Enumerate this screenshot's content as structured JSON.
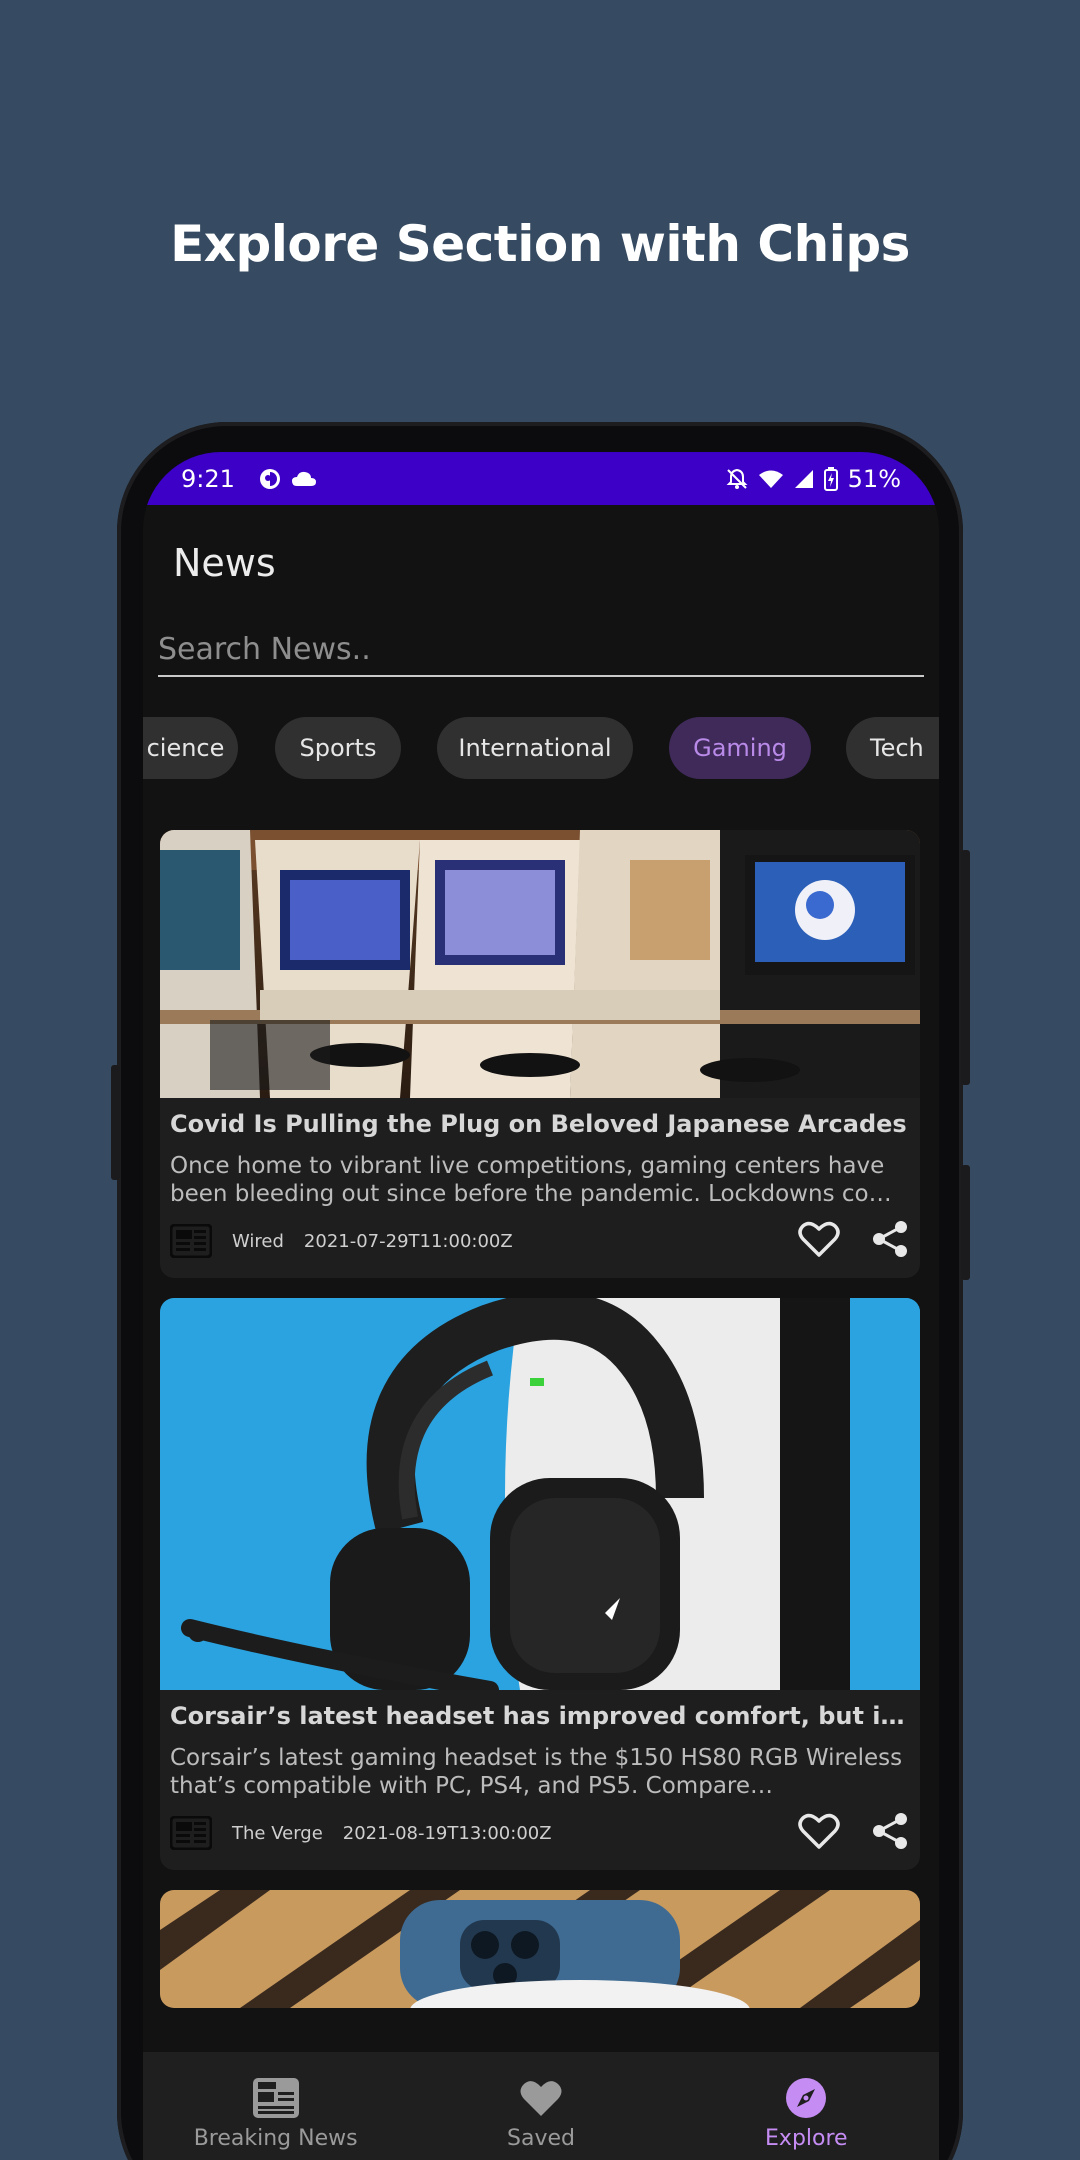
{
  "headline": "Explore Section with Chips",
  "status_bar": {
    "time": "9:21",
    "battery": "51%",
    "left_icons": [
      "app-notification-icon",
      "cloud-icon"
    ],
    "right_icons": [
      "bell-off-icon",
      "wifi-icon",
      "signal-icon",
      "battery-icon"
    ]
  },
  "app": {
    "title": "News",
    "search_placeholder": "Search News.."
  },
  "chips": [
    {
      "label": "cience",
      "selected": false
    },
    {
      "label": "Sports",
      "selected": false
    },
    {
      "label": "International",
      "selected": false
    },
    {
      "label": "Gaming",
      "selected": true
    },
    {
      "label": "Tech",
      "selected": false
    }
  ],
  "articles": [
    {
      "title": "Covid Is Pulling the Plug on Beloved Japanese Arcades",
      "description": "Once home to vibrant live competitions, gaming centers have been bleeding out since before the pandemic. Lockdowns co…",
      "source": "Wired",
      "date": "2021-07-29T11:00:00Z"
    },
    {
      "title": "Corsair’s latest headset has improved comfort, but it back…",
      "description": "Corsair’s latest gaming headset is the $150 HS80 RGB Wireless that’s compatible with PC, PS4, and PS5. Compare…",
      "source": "The Verge",
      "date": "2021-08-19T13:00:00Z"
    }
  ],
  "bottom_nav": [
    {
      "label": "Breaking News",
      "icon": "newspaper-icon",
      "active": false
    },
    {
      "label": "Saved",
      "icon": "heart-icon",
      "active": false
    },
    {
      "label": "Explore",
      "icon": "compass-icon",
      "active": true
    }
  ],
  "colors": {
    "background": "#364b61",
    "status_bar": "#3d00c7",
    "accent": "#c58cf3",
    "selected_chip_bg": "#3f2a5a"
  }
}
